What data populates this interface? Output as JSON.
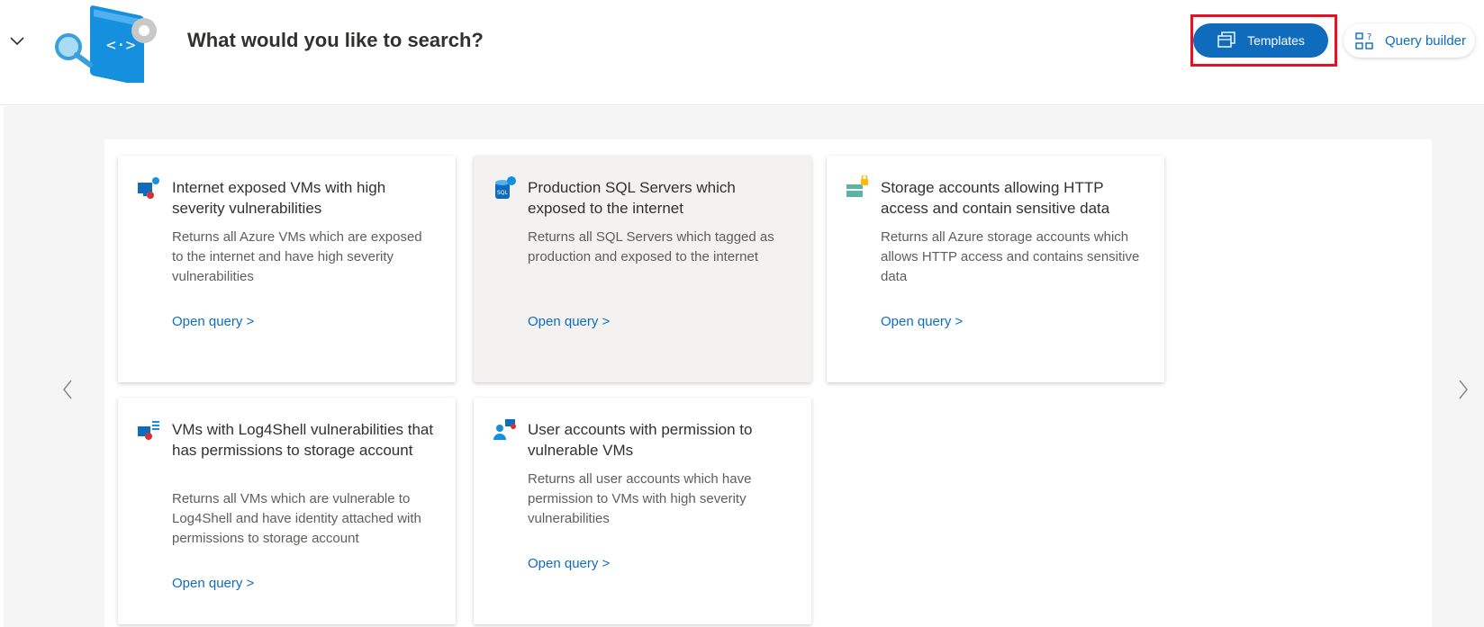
{
  "header": {
    "title": "What would you like to search?",
    "templates_label": "Templates",
    "query_builder_label": "Query builder"
  },
  "colors": {
    "accent": "#0f6cbd",
    "highlight": "#e81123",
    "text": "#323130",
    "muted": "#605e5c"
  },
  "cards": [
    {
      "title": "Internet exposed VMs with high severity vulnerabilities",
      "description": "Returns all Azure VMs which are exposed to the internet and have high severity vulnerabilities",
      "link": "Open query >",
      "icon": "vm-alert-icon"
    },
    {
      "title": "Production SQL Servers which exposed to the internet",
      "description": "Returns all SQL Servers which tagged as production and exposed to the internet",
      "link": "Open query >",
      "icon": "sql-database-icon"
    },
    {
      "title": "Storage accounts allowing HTTP access and contain sensitive data",
      "description": "Returns all Azure storage accounts which allows HTTP access and contains sensitive data",
      "link": "Open query >",
      "icon": "storage-lock-icon"
    },
    {
      "title": "VMs with Log4Shell vulnerabilities that has permissions to storage account",
      "description": "Returns all VMs which are vulnerable to Log4Shell and have identity attached with permissions to storage account",
      "link": "Open query >",
      "icon": "vm-list-icon"
    },
    {
      "title": "User accounts with permission to vulnerable VMs",
      "description": "Returns all user accounts which have permission to VMs with high severity vulnerabilities",
      "link": "Open query >",
      "icon": "user-vm-icon"
    }
  ]
}
